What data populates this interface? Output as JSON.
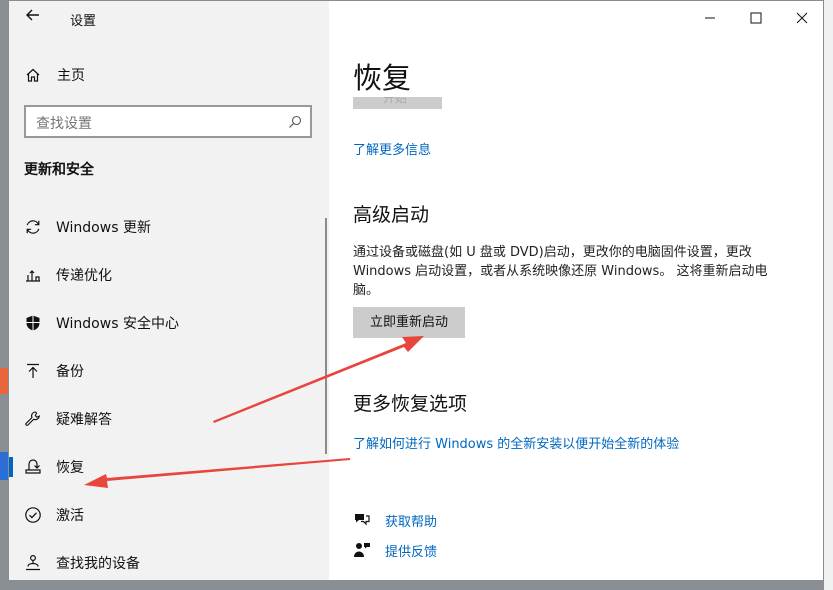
{
  "window": {
    "title": "设置"
  },
  "sidebar": {
    "home_label": "主页",
    "search_placeholder": "查找设置",
    "section_title": "更新和安全",
    "items": [
      {
        "label": "Windows 更新",
        "icon": "refresh-icon"
      },
      {
        "label": "传递优化",
        "icon": "delivery-icon"
      },
      {
        "label": "Windows 安全中心",
        "icon": "shield-icon"
      },
      {
        "label": "备份",
        "icon": "backup-arrow-icon"
      },
      {
        "label": "疑难解答",
        "icon": "wrench-icon"
      },
      {
        "label": "恢复",
        "icon": "recovery-icon",
        "active": true
      },
      {
        "label": "激活",
        "icon": "check-circle-icon"
      },
      {
        "label": "查找我的设备",
        "icon": "person-pin-icon"
      }
    ]
  },
  "main": {
    "title": "恢复",
    "hidden_button_label": "开始",
    "learn_more_link": "了解更多信息",
    "advanced_startup": {
      "title": "高级启动",
      "description": "通过设备或磁盘(如 U 盘或 DVD)启动，更改你的电脑固件设置，更改 Windows 启动设置，或者从系统映像还原 Windows。 这将重新启动电脑。",
      "button_label": "立即重新启动"
    },
    "more_recovery": {
      "title": "更多恢复选项",
      "link": "了解如何进行 Windows 的全新安装以便开始全新的体验"
    },
    "get_help_label": "获取帮助",
    "feedback_label": "提供反馈"
  },
  "colors": {
    "accent": "#0067c0",
    "arrow": "#e8453c",
    "sidebar_bg": "#f2f2f2"
  }
}
